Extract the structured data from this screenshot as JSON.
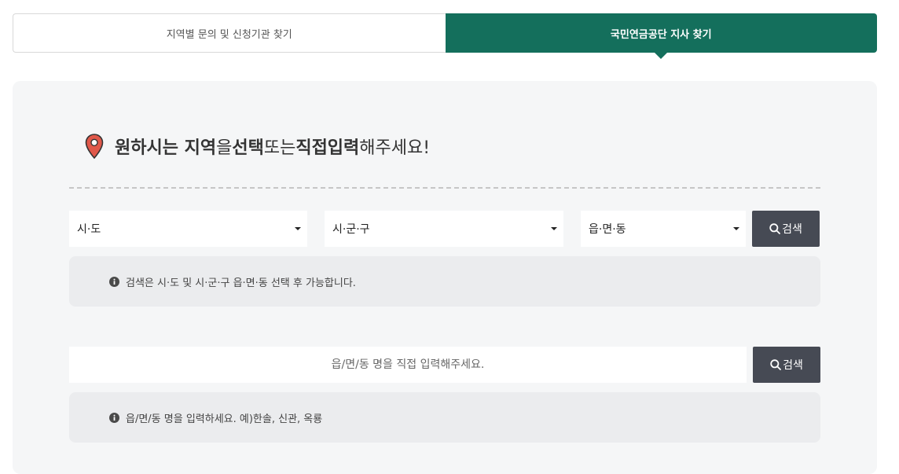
{
  "tabs": [
    {
      "label": "지역별 문의 및 신청기관 찾기",
      "active": false
    },
    {
      "label": "국민연금공단 지사 찾기",
      "active": true
    }
  ],
  "heading": {
    "part1": "원하시는 지역",
    "part2": "을 ",
    "part3": "선택",
    "part4": " 또는 ",
    "part5": "직접입력",
    "part6": "해주세요!"
  },
  "selects": {
    "sido": "시·도",
    "sigungu": "시·군·구",
    "dong": "읍·면·동"
  },
  "search_label": "검색",
  "notice_select": "검색은 시·도 및 시·군·구 읍·면·동 선택 후 가능합니다.",
  "direct": {
    "placeholder": "읍/면/동 명을 직접 입력해주세요."
  },
  "notice_direct": "읍/면/동 명을 입력하세요. 예)한솔, 신관, 옥룡",
  "colors": {
    "accent": "#146f5c",
    "button": "#464a54",
    "pin": "#e0584a"
  },
  "icons": {
    "pin": "map-pin-icon",
    "search": "search-icon",
    "info": "info-icon",
    "dropdown": "chevron-down-icon"
  }
}
